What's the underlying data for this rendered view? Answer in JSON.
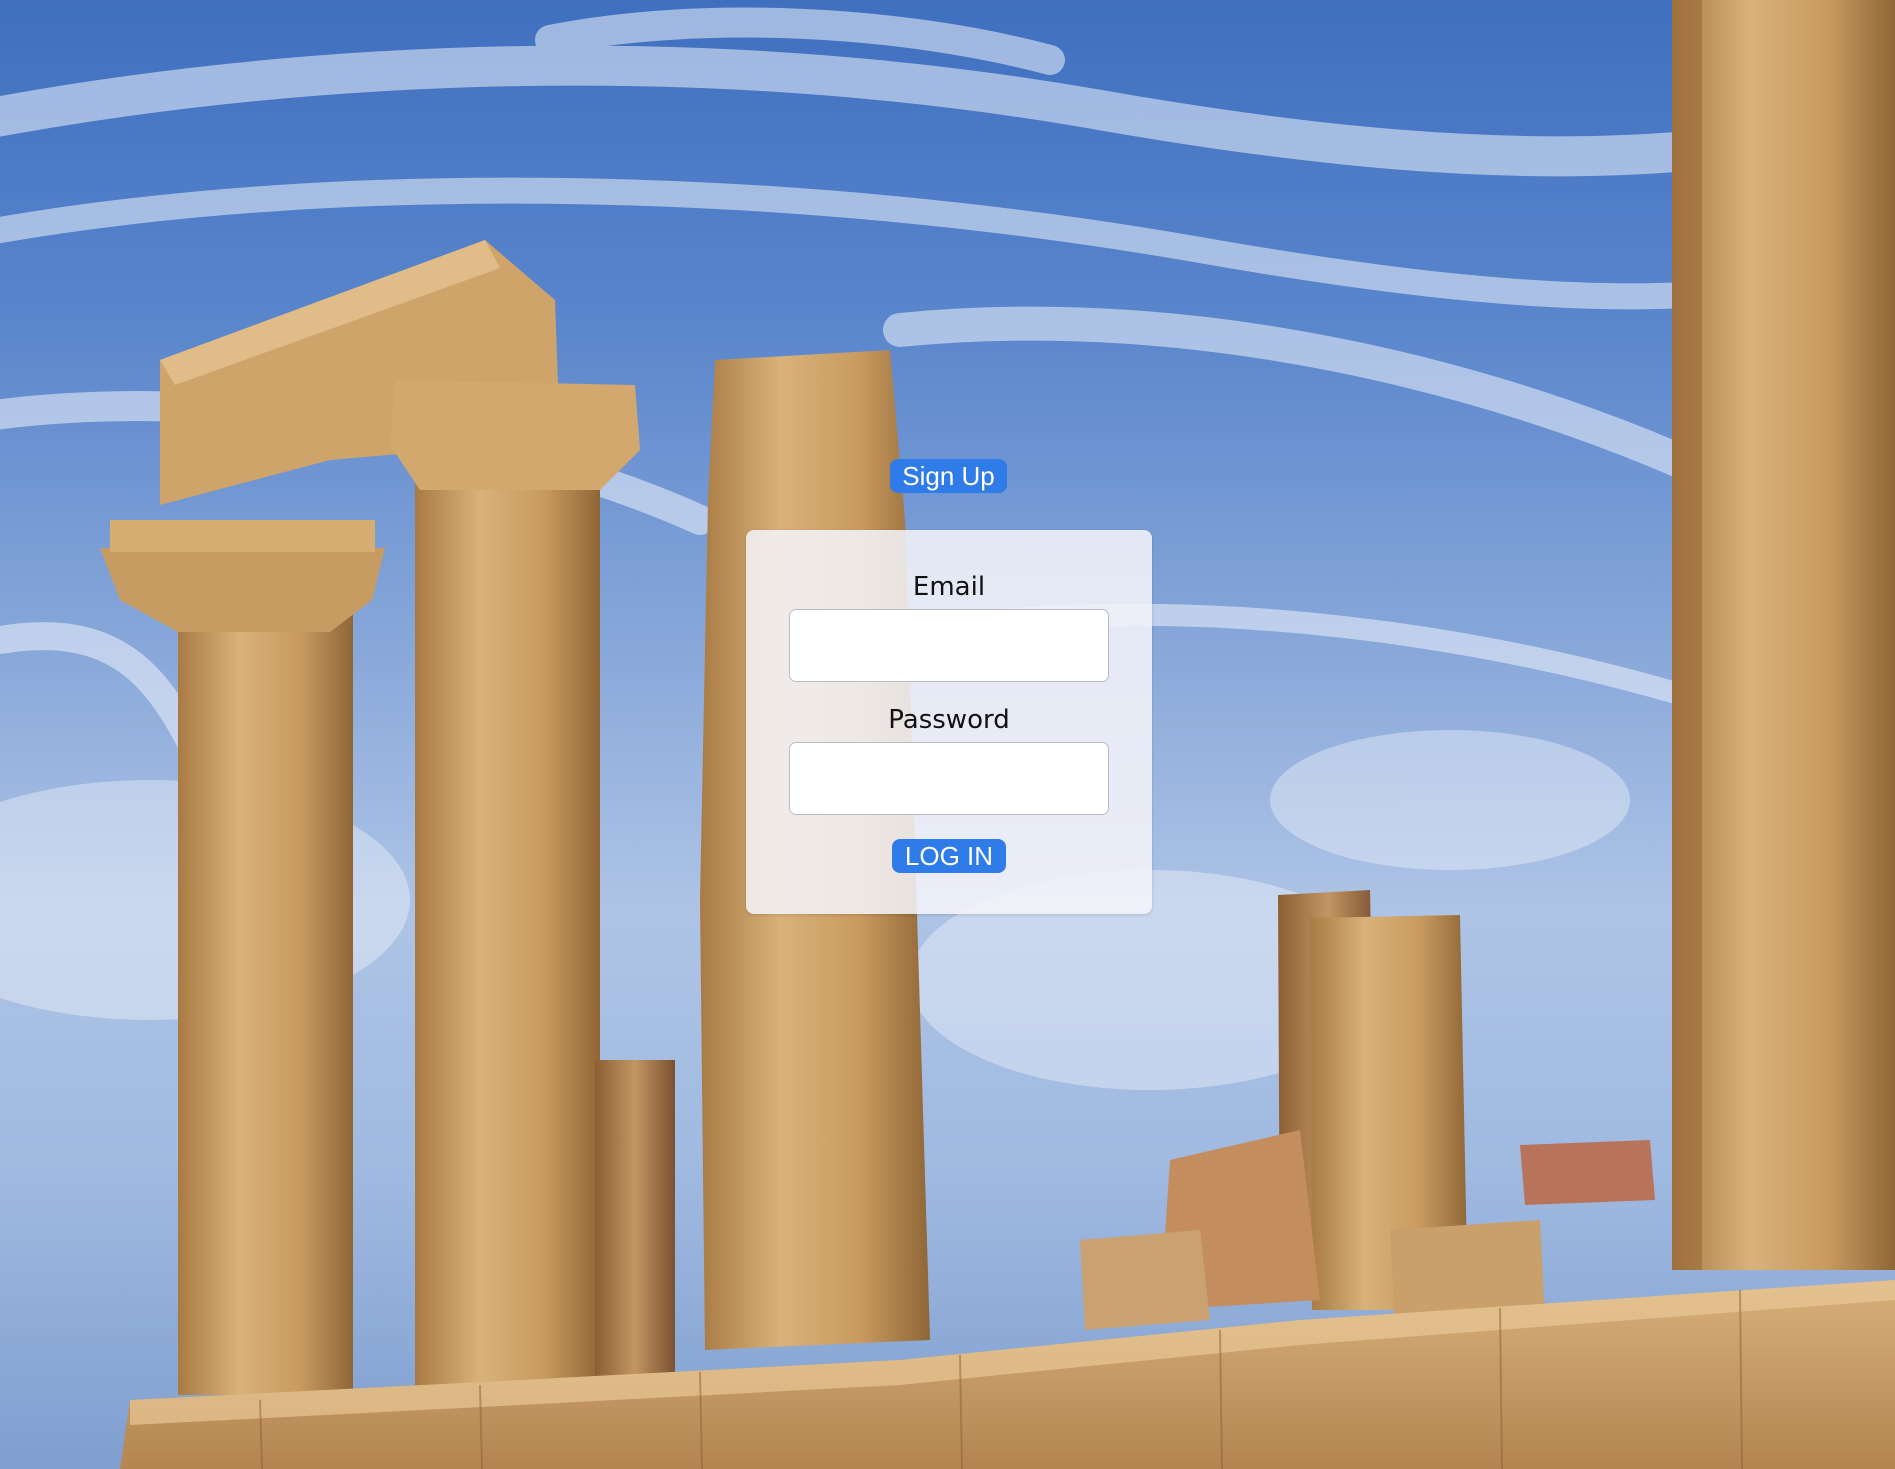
{
  "header": {
    "signup_label": "Sign Up"
  },
  "login_form": {
    "email_label": "Email",
    "email_value": "",
    "password_label": "Password",
    "password_value": "",
    "login_label": "LOG IN"
  },
  "colors": {
    "accent": "#2f7ce8",
    "card_background": "#f4f5fa",
    "sky": "#5a86cc",
    "stone": "#c9a06a"
  }
}
